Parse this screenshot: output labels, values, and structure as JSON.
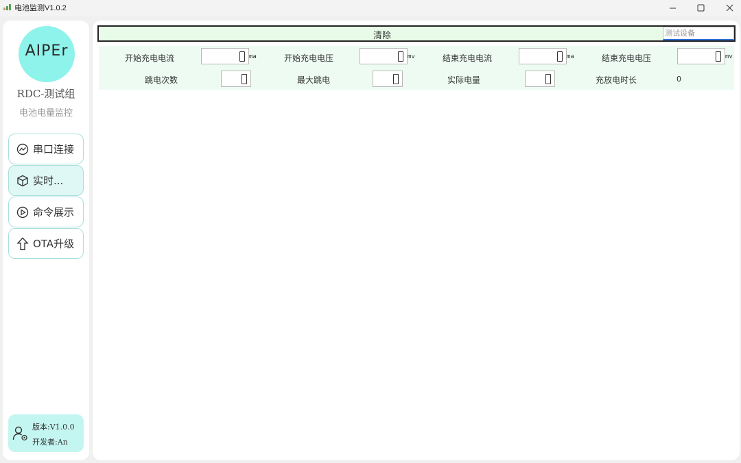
{
  "window": {
    "title": "电池监测V1.0.2",
    "buttons": {
      "minimize": "—",
      "maximize": "☐",
      "close": "✕"
    }
  },
  "sidebar": {
    "logo_text": "AIPEr",
    "group_name": "RDC-测试组",
    "group_subtitle": "电池电量监控",
    "nav": [
      {
        "label": "串口连接",
        "icon": "chart-circle-icon"
      },
      {
        "label": "实时...",
        "icon": "cube-icon",
        "active": true
      },
      {
        "label": "命令展示",
        "icon": "play-circle-icon"
      },
      {
        "label": "OTA升级",
        "icon": "upload-arrow-icon"
      }
    ],
    "version": "版本:V1.0.0",
    "developer": "开发者:An"
  },
  "main": {
    "clear_label": "清除",
    "device_placeholder": "测试设备",
    "row1": [
      {
        "label": "开始充电电流",
        "value": "0",
        "unit": "ma"
      },
      {
        "label": "开始充电电压",
        "value": "0",
        "unit": "mv"
      },
      {
        "label": "结束充电电流",
        "value": "0",
        "unit": "ma"
      },
      {
        "label": "结束充电电压",
        "value": "0",
        "unit": "mv"
      }
    ],
    "row2": [
      {
        "label": "跳电次数",
        "value": "0"
      },
      {
        "label": "最大跳电",
        "value": "0"
      },
      {
        "label": "实际电量",
        "value": "0"
      },
      {
        "label": "充放电时长",
        "value": "0"
      }
    ]
  },
  "colors": {
    "accent": "#8ef3ea",
    "nav_border": "#a9dfdc",
    "active_nav": "#dff7f5",
    "param_bg": "#edfbf3",
    "focus_underline": "#2c6fd6"
  }
}
